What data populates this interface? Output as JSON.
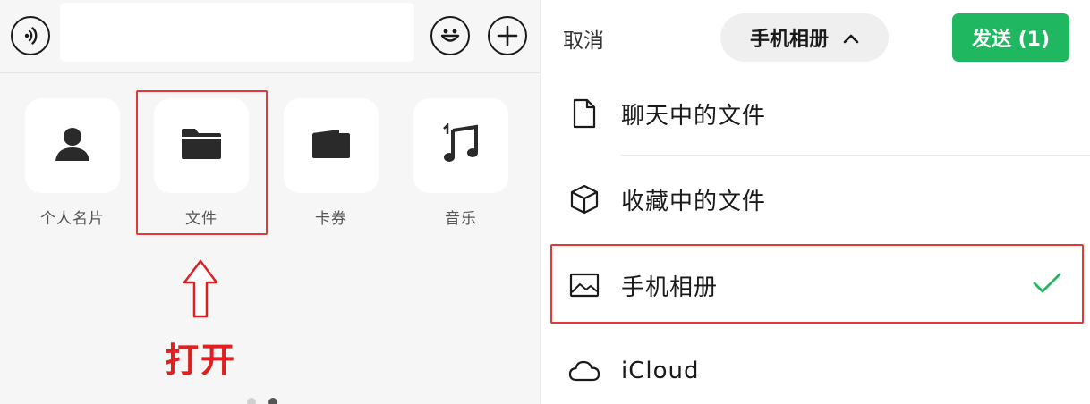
{
  "composer": {
    "voice_icon": "voice-icon",
    "emoji_icon": "emoji-icon",
    "plus_icon": "plus-icon",
    "input_value": "",
    "input_placeholder": ""
  },
  "apps": [
    {
      "label": "个人名片",
      "icon": "person-icon"
    },
    {
      "label": "文件",
      "icon": "folder-icon"
    },
    {
      "label": "卡券",
      "icon": "wallet-icon"
    },
    {
      "label": "音乐",
      "icon": "music-icon"
    }
  ],
  "annotation": {
    "open_label": "打开",
    "highlight_color": "#e23a3a",
    "arrow_color": "#e02020"
  },
  "page_indicator": {
    "count": 2,
    "active": 2
  },
  "picker": {
    "cancel_label": "取消",
    "source_label": "手机相册",
    "source_chevron": "chevron-up-icon",
    "send_label": "发送 (1)",
    "send_color": "#1fb860",
    "options": [
      {
        "label": "聊天中的文件",
        "icon": "document-icon",
        "selected": false
      },
      {
        "label": "收藏中的文件",
        "icon": "cube-icon",
        "selected": false
      },
      {
        "label": "手机相册",
        "icon": "image-icon",
        "selected": true
      },
      {
        "label": "iCloud",
        "icon": "cloud-icon",
        "selected": false
      }
    ],
    "check_color": "#1fb860"
  }
}
